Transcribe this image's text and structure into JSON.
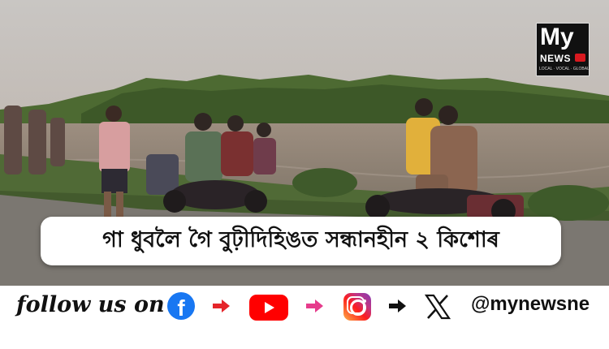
{
  "headline": "গা ধুবলৈ গৈ বুঢ়ীদিহিঙত সন্ধানহীন ২ কিশোৰ",
  "logo": {
    "my": "My",
    "news": "NEWS",
    "tagline": "LOCAL · VOCAL · GLOBAL"
  },
  "social": {
    "follow_label": "follow us on",
    "handle": "@mynewsne",
    "icons": [
      "facebook-icon",
      "youtube-icon",
      "instagram-icon",
      "x-icon"
    ],
    "colors": {
      "facebook": "#1877f2",
      "youtube": "#ff0000",
      "arrow_red": "#e5252a",
      "arrow_pink": "#e63c8c",
      "arrow_black": "#111111"
    }
  }
}
